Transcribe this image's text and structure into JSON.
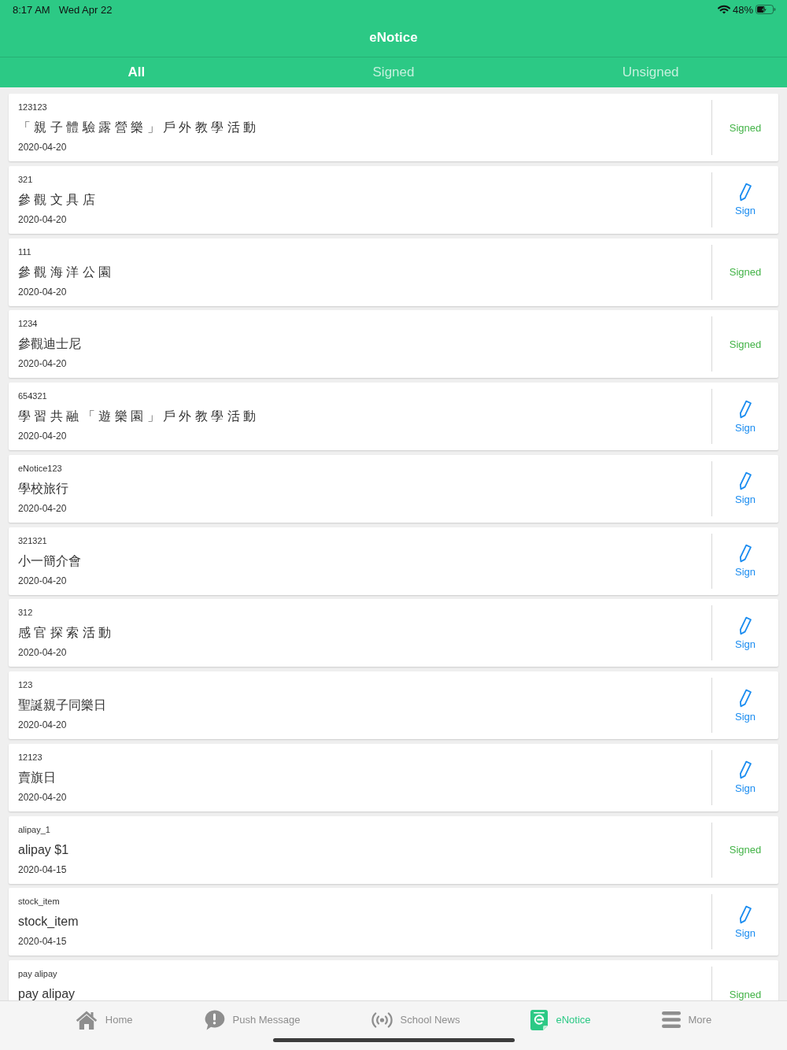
{
  "status_bar": {
    "time": "8:17 AM",
    "date": "Wed Apr 22",
    "battery": "48%"
  },
  "header": {
    "title": "eNotice"
  },
  "tabs": [
    {
      "label": "All",
      "selected": true
    },
    {
      "label": "Signed",
      "selected": false
    },
    {
      "label": "Unsigned",
      "selected": false
    }
  ],
  "notices": [
    {
      "code": "123123",
      "title": "「 親 子 體 驗 露 營 樂 」 戶 外 教 學 活 動",
      "date": "2020-04-20",
      "signed": true,
      "action": "Signed"
    },
    {
      "code": "321",
      "title": "參 觀 文 具 店",
      "date": "2020-04-20",
      "signed": false,
      "action": "Sign"
    },
    {
      "code": "111",
      "title": "參 觀 海 洋 公 園",
      "date": "2020-04-20",
      "signed": true,
      "action": "Signed"
    },
    {
      "code": "1234",
      "title": "參觀迪士尼",
      "date": "2020-04-20",
      "signed": true,
      "action": "Signed"
    },
    {
      "code": "654321",
      "title": "學 習 共 融 「 遊 樂 園 」 戶 外 教 學 活 動",
      "date": "2020-04-20",
      "signed": false,
      "action": "Sign"
    },
    {
      "code": "eNotice123",
      "title": "學校旅行",
      "date": "2020-04-20",
      "signed": false,
      "action": "Sign"
    },
    {
      "code": "321321",
      "title": "小一簡介會",
      "date": "2020-04-20",
      "signed": false,
      "action": "Sign"
    },
    {
      "code": "312",
      "title": "感 官 探 索 活 動",
      "date": "2020-04-20",
      "signed": false,
      "action": "Sign"
    },
    {
      "code": "123",
      "title": "聖誕親子同樂日",
      "date": "2020-04-20",
      "signed": false,
      "action": "Sign"
    },
    {
      "code": "12123",
      "title": "賣旗日",
      "date": "2020-04-20",
      "signed": false,
      "action": "Sign"
    },
    {
      "code": "alipay_1",
      "title": "alipay $1",
      "date": "2020-04-15",
      "signed": true,
      "action": "Signed"
    },
    {
      "code": "stock_item",
      "title": "stock_item",
      "date": "2020-04-15",
      "signed": false,
      "action": "Sign"
    },
    {
      "code": "pay alipay",
      "title": "pay alipay",
      "signed": true,
      "action": "Signed"
    }
  ],
  "tab_bar": [
    {
      "label": "Home",
      "selected": false
    },
    {
      "label": "Push Message",
      "selected": false
    },
    {
      "label": "School News",
      "selected": false
    },
    {
      "label": "eNotice",
      "selected": true
    },
    {
      "label": "More",
      "selected": false
    }
  ]
}
